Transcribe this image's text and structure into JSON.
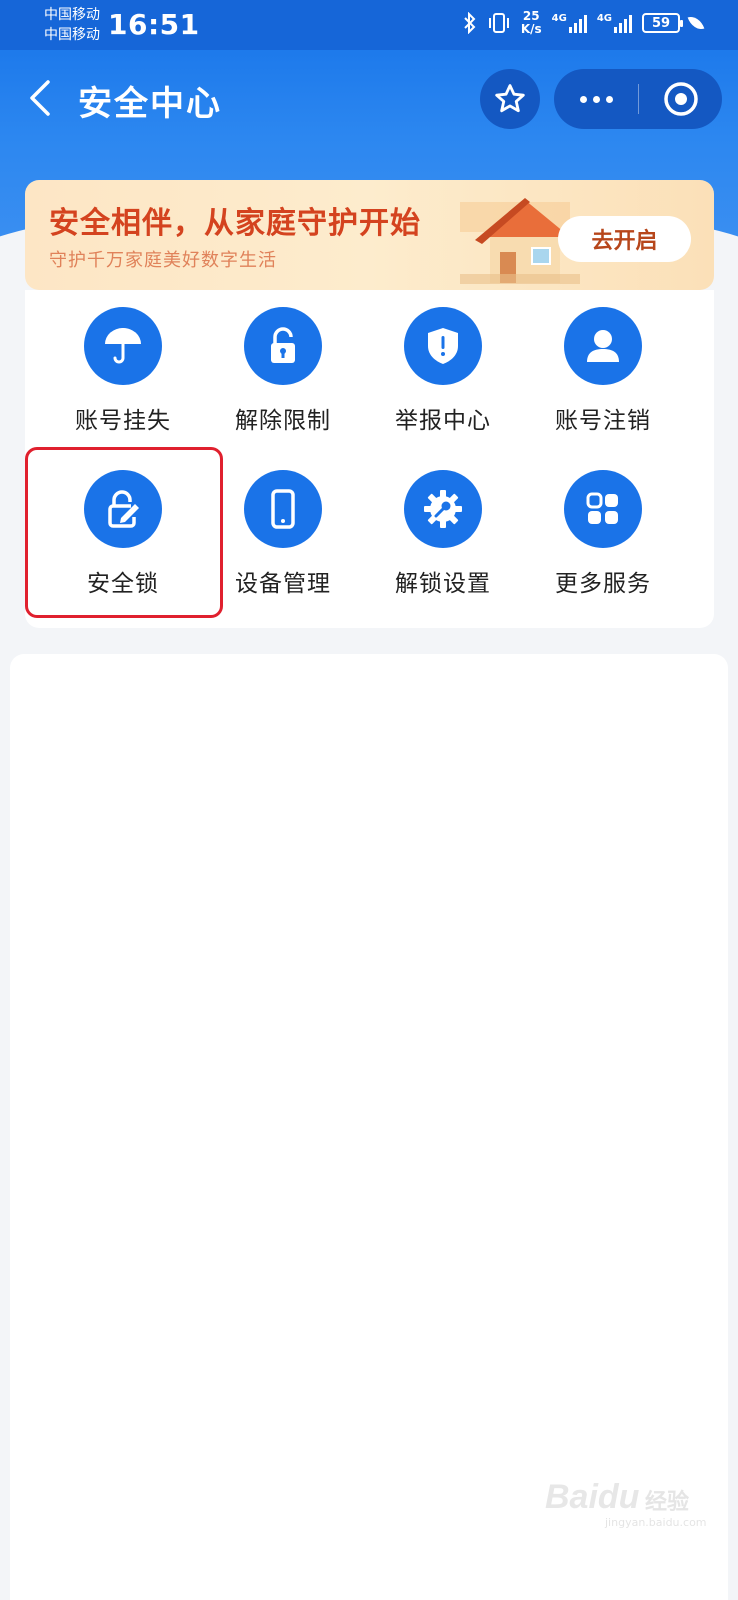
{
  "status_bar": {
    "carrier_1": "中国移动",
    "carrier_2": "中国移动",
    "time": "16:51",
    "net_speed_value": "25",
    "net_speed_unit": "K/s",
    "network_1": "4G",
    "network_2": "4G",
    "battery": "59"
  },
  "nav": {
    "back_icon": "chevron-left-icon",
    "title": "安全中心",
    "favorite_icon": "star-icon",
    "more_icon": "more-dots-icon",
    "close_icon": "target-circle-icon"
  },
  "banner": {
    "title": "安全相伴，从家庭守护开始",
    "subtitle": "守护千万家庭美好数字生活",
    "button": "去开启",
    "title_color": "#d4431f"
  },
  "services": [
    {
      "label": "账号挂失",
      "icon": "umbrella-icon"
    },
    {
      "label": "解除限制",
      "icon": "unlock-icon"
    },
    {
      "label": "举报中心",
      "icon": "shield-alert-icon"
    },
    {
      "label": "账号注销",
      "icon": "user-icon"
    },
    {
      "label": "安全锁",
      "icon": "lock-edit-icon"
    },
    {
      "label": "设备管理",
      "icon": "phone-icon"
    },
    {
      "label": "解锁设置",
      "icon": "gear-key-icon"
    },
    {
      "label": "更多服务",
      "icon": "grid-icon"
    }
  ],
  "highlight": {
    "target": "安全锁",
    "color": "#e0202e"
  },
  "colors": {
    "primary": "#1a73e8",
    "header": "#1572e8"
  },
  "watermark": {
    "logo": "Baidu",
    "cn": "经验",
    "sub": "jingyan.baidu.com"
  }
}
